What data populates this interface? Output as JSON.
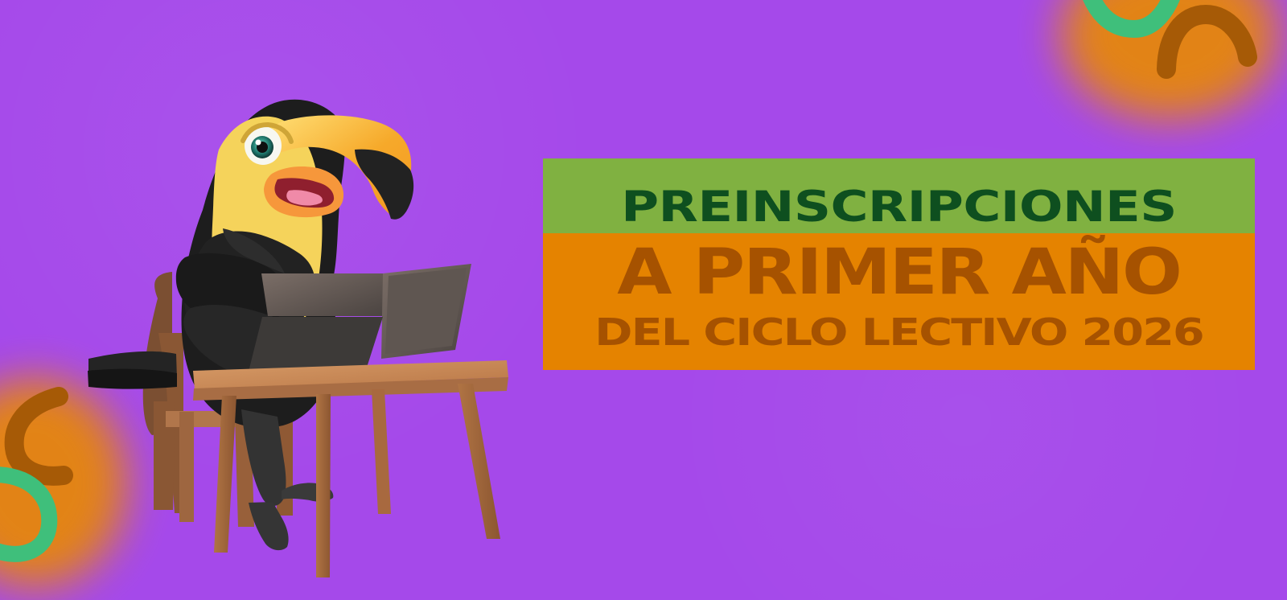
{
  "banner": {
    "line_1": "PREINSCRIPCIONES",
    "line_2": "A PRIMER AÑO",
    "line_3": "DEL CICLO LECTIVO 2026"
  },
  "colors": {
    "background": "#a549ea",
    "title_top_band": "#80b141",
    "title_bottom_band": "#e58300",
    "title_green_text": "#0e4f1f",
    "title_orange_text": "#a65200",
    "accent_orange": "#e6870b",
    "accent_green": "#3fbf7b",
    "accent_brown": "#a65a06"
  },
  "icons": {
    "mascot": "toucan-at-laptop-illustration",
    "decoration_top_right": "abstract-curved-shapes",
    "decoration_bottom_left": "abstract-curved-shapes"
  }
}
